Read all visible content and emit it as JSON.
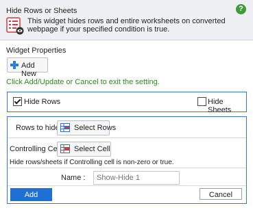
{
  "header": {
    "title": "Hide Rows or Sheets",
    "description": "This widget hides rows and entire worksheets on converted webpage if your specified condition is true.",
    "help_glyph": "?",
    "icon": "list-eye-icon"
  },
  "properties": {
    "title": "Widget Properties",
    "add_new_label": "Add New",
    "hint": "Click Add/Update or Cancel to exit the setting."
  },
  "options": {
    "hide_rows_label": "Hide Rows",
    "hide_rows_checked": true,
    "hide_sheets_label": "Hide Sheets",
    "hide_sheets_checked": false
  },
  "form": {
    "rows_label": "Rows to hide :",
    "select_rows_label": "Select Rows",
    "cell_label": "Controlling Cell :",
    "select_cell_label": "Select Cell",
    "note": "Hide rows/sheets if Controlling cell is non-zero or true.",
    "name_label": "Name :",
    "name_placeholder": "Show-Hide 1",
    "add_label": "Add",
    "cancel_label": "Cancel"
  },
  "colors": {
    "accent": "#1f6fd6",
    "hint_green": "#2f8a1f",
    "help_green": "#3e9b3a",
    "panel_border": "#2f7bd2",
    "header_bg": "#eef0f3"
  }
}
